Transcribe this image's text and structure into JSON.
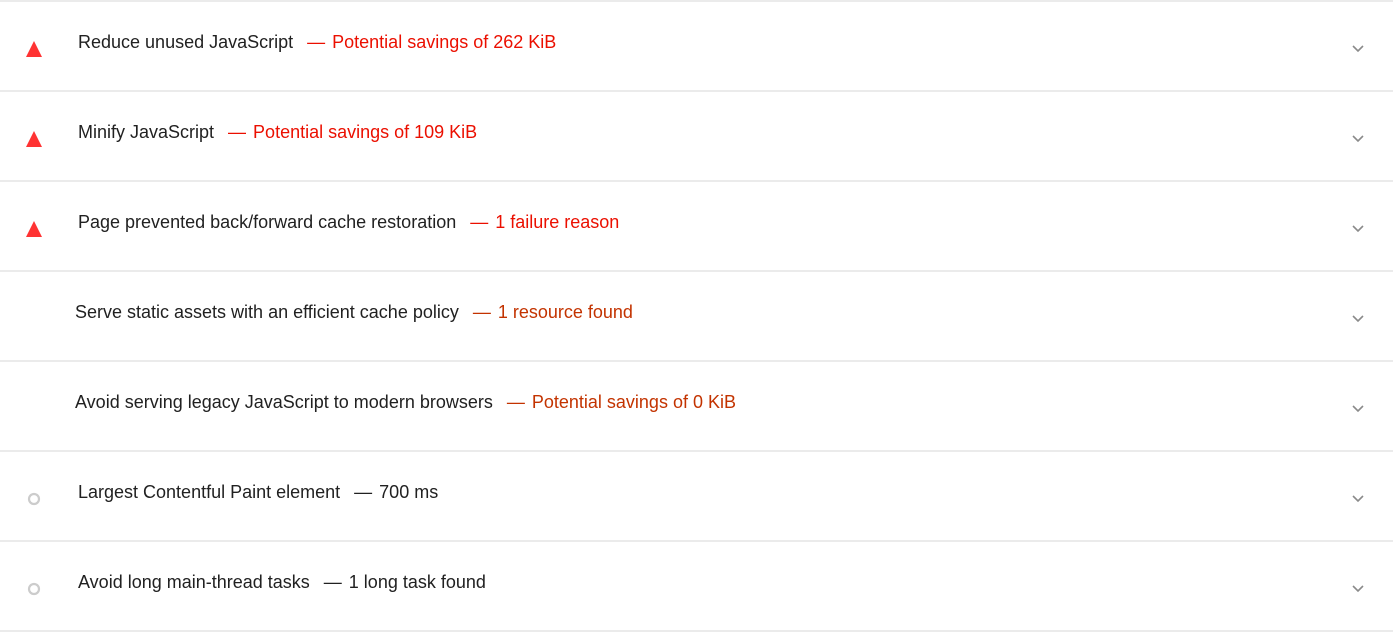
{
  "audits": [
    {
      "status": "fail",
      "icon": "triangle-warning-icon",
      "title": "Reduce unused JavaScript",
      "dash": "—",
      "display_value": "Potential savings of 262 KiB"
    },
    {
      "status": "fail",
      "icon": "triangle-warning-icon",
      "title": "Minify JavaScript",
      "dash": "—",
      "display_value": "Potential savings of 109 KiB"
    },
    {
      "status": "fail",
      "icon": "triangle-warning-icon",
      "title": "Page prevented back/forward cache restoration",
      "dash": "—",
      "display_value": "1 failure reason"
    },
    {
      "status": "average",
      "icon": "",
      "title": "Serve static assets with an efficient cache policy",
      "dash": "—",
      "display_value": "1 resource found"
    },
    {
      "status": "average",
      "icon": "",
      "title": "Avoid serving legacy JavaScript to modern browsers",
      "dash": "—",
      "display_value": "Potential savings of 0 KiB"
    },
    {
      "status": "info",
      "icon": "circle-info-icon",
      "title": "Largest Contentful Paint element",
      "dash": "—",
      "display_value": "700 ms"
    },
    {
      "status": "info",
      "icon": "circle-info-icon",
      "title": "Avoid long main-thread tasks",
      "dash": "—",
      "display_value": "1 long task found"
    }
  ],
  "colors": {
    "fail": "#eb0f00",
    "fail_icon": "#ff3333",
    "average": "#c33300",
    "info_icon": "#cccccc",
    "divider": "#ebebeb",
    "chevron": "#8a8a8a",
    "text": "#212121"
  },
  "chevron_icon": "chevron-down-icon"
}
